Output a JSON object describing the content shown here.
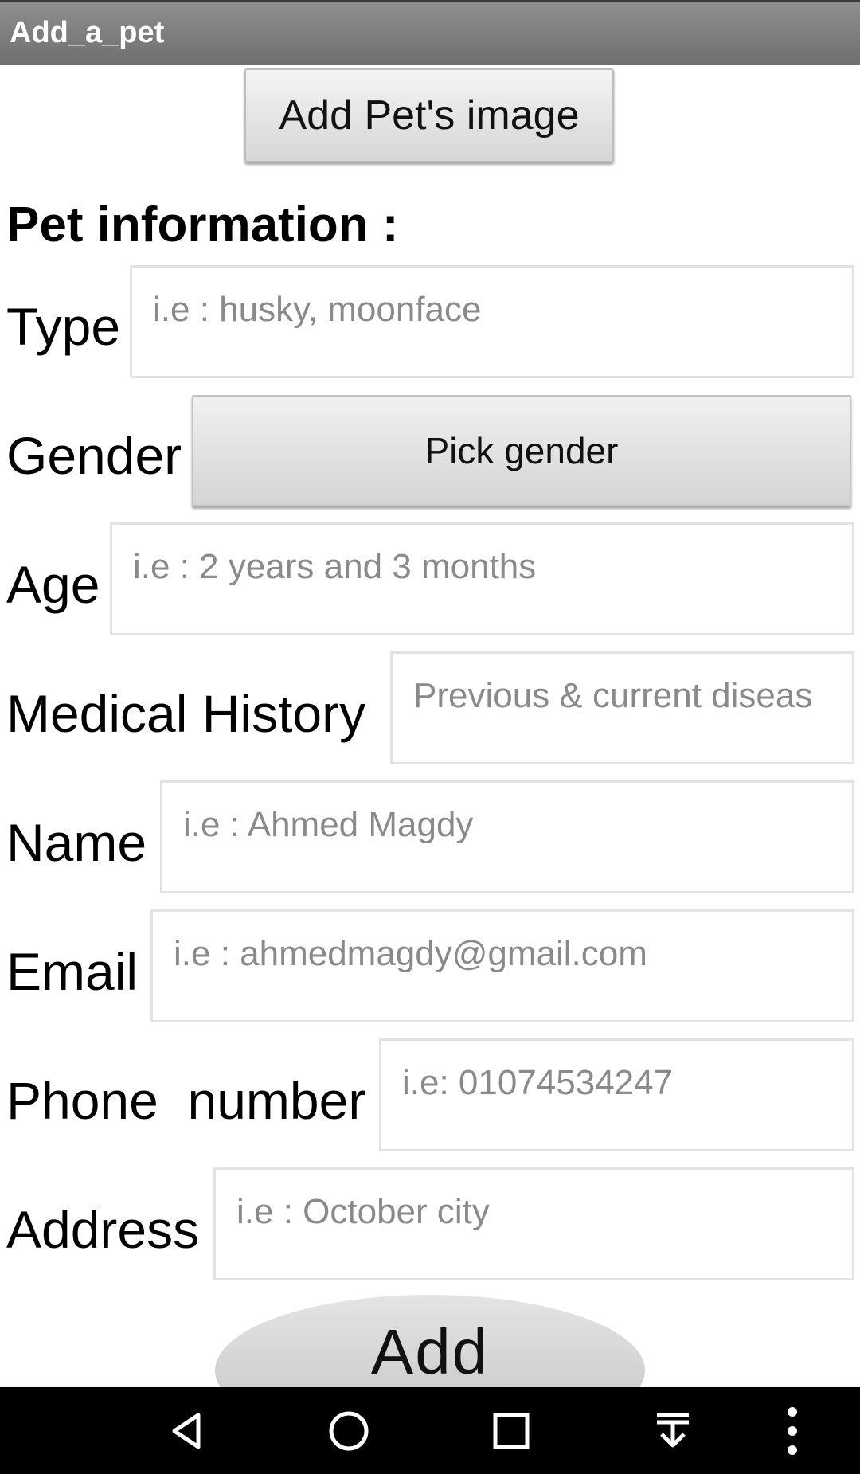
{
  "app": {
    "title": "Add_a_pet"
  },
  "form": {
    "add_image_button": "Add Pet's image",
    "section_title": "Pet information :",
    "type": {
      "label": "Type",
      "placeholder": "i.e : husky, moonface"
    },
    "gender": {
      "label": "Gender",
      "button": "Pick gender"
    },
    "age": {
      "label": "Age",
      "placeholder": "i.e : 2 years and 3 months"
    },
    "medical_history": {
      "label": "Medical History",
      "placeholder": "Previous & current diseas"
    },
    "name": {
      "label": "Name",
      "placeholder": "i.e : Ahmed Magdy"
    },
    "email": {
      "label": "Email",
      "placeholder": "i.e : ahmedmagdy@gmail.com"
    },
    "phone": {
      "label": "Phone  number",
      "placeholder": "i.e: 01074534247"
    },
    "address": {
      "label": "Address",
      "placeholder": "i.e : October city"
    },
    "add_button": "Add"
  },
  "navbar": {
    "icons": [
      "back-icon",
      "home-icon",
      "recents-icon",
      "download-icon",
      "overflow-menu-icon"
    ]
  },
  "colors": {
    "titlebar": "#7f7f7f",
    "navbar": "#000000",
    "placeholder_text": "#8a8a8a",
    "field_border": "#e3e3e3"
  }
}
